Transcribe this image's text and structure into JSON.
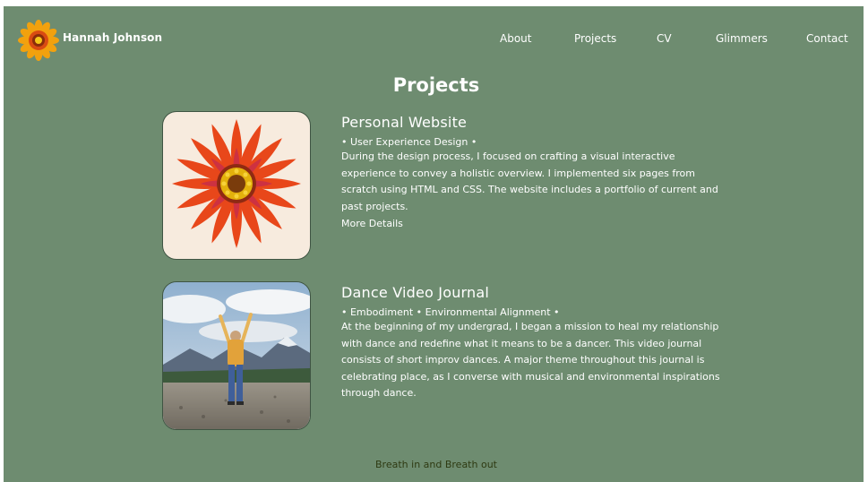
{
  "header": {
    "site_name": "Hannah Johnson",
    "nav": [
      "About",
      "Projects",
      "CV",
      "Glimmers",
      "Contact"
    ]
  },
  "main": {
    "title": "Projects",
    "projects": [
      {
        "title": "Personal Website",
        "tags": "• User Experience Design •",
        "description": "During the design process, I focused on crafting a visual interactive experience to convey a holistic overview. I implemented six pages from scratch using HTML and CSS. The website includes a portfolio of current and past projects.",
        "link": "More Details"
      },
      {
        "title": "Dance Video Journal",
        "tags": "• Embodiment • Environmental Alignment •",
        "description": "At the beginning of my undergrad, I began a mission to heal my relationship with dance and redefine what it means to be a dancer. This video journal consists of short improv dances. A major theme throughout this journal is celebrating place, as I converse with musical and environmental inspirations through dance."
      }
    ]
  },
  "footer": {
    "text": "Breath in and Breath out"
  },
  "colors": {
    "background": "#6e8c70",
    "text": "#ffffff",
    "footer_text": "#2e3a12"
  }
}
